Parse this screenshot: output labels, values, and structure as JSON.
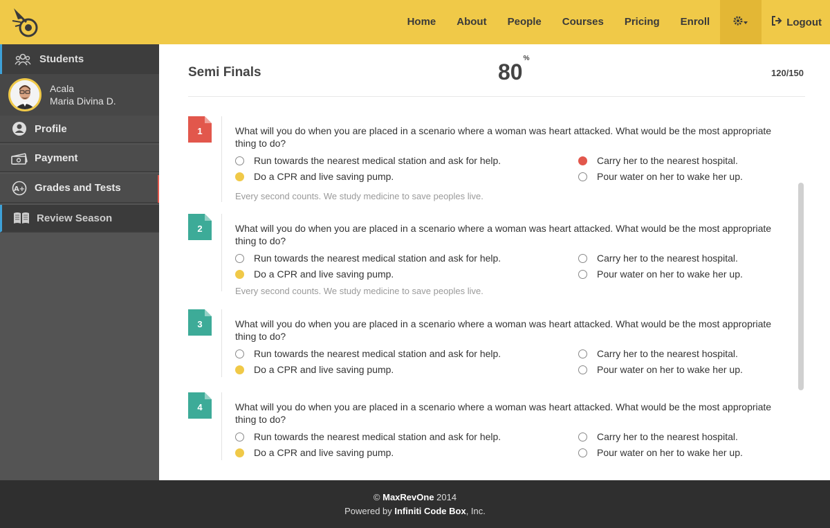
{
  "nav": {
    "items": [
      "Home",
      "About",
      "People",
      "Courses",
      "Pricing",
      "Enroll"
    ],
    "logout": "Logout"
  },
  "sidebar": {
    "students": "Students",
    "user": {
      "line1": "Acala",
      "line2": "Maria Divina D."
    },
    "items": [
      {
        "label": "Profile",
        "icon": "user-circle-icon"
      },
      {
        "label": "Payment",
        "icon": "money-icon"
      },
      {
        "label": "Grades and Tests",
        "icon": "grade-icon"
      },
      {
        "label": "Review Season",
        "icon": "book-icon"
      }
    ]
  },
  "test": {
    "title": "Semi Finals",
    "score": "80",
    "score_unit": "%",
    "count": "120/150"
  },
  "questions": [
    {
      "number": "1",
      "color": "#e2574c",
      "text": "What will you do when you are placed in a scenario where a woman was heart attacked. What would be the most appropriate thing to do?",
      "options": [
        "Run towards the nearest medical station and ask for help.",
        "Carry her to the nearest hospital.",
        "Do a CPR and live saving pump.",
        "Pour water on her to wake her up."
      ],
      "hint": "Every second counts. We study medicine to save peoples live."
    },
    {
      "number": "2",
      "color": "#3dab98",
      "text": "What will you do when you are placed in a scenario where a woman was heart attacked. What would be the most appropriate thing to do?",
      "options": [
        "Run towards the nearest medical station and ask for help.",
        "Carry her to the nearest hospital.",
        "Do a CPR and live saving pump.",
        "Pour water on her to wake her up."
      ],
      "hint": "Every second counts. We study medicine to save peoples live."
    },
    {
      "number": "3",
      "color": "#3dab98",
      "text": "What will you do when you are placed in a scenario where a woman was heart attacked. What would be the most appropriate thing to do?",
      "options": [
        "Run towards the nearest medical station and ask for help.",
        "Carry her to the nearest hospital.",
        "Do a CPR and live saving pump.",
        "Pour water on her to wake her up."
      ]
    },
    {
      "number": "4",
      "color": "#3dab98",
      "text": "What will you do when you are placed in a scenario where a woman was heart attacked. What would be the most appropriate thing to do?",
      "options": [
        "Run towards the nearest medical station and ask for help.",
        "Carry her to the nearest hospital.",
        "Do a CPR and live saving pump.",
        "Pour water on her to wake her up."
      ]
    }
  ],
  "footer": {
    "copyright": "©",
    "brand": "MaxRevOne",
    "year": "2014",
    "powered": "Powered by",
    "company": "Infiniti Code Box",
    "suffix": ", Inc."
  },
  "colors": {
    "brand_yellow": "#f0c948",
    "wrong_red": "#e2574c",
    "teal": "#3dab98"
  }
}
